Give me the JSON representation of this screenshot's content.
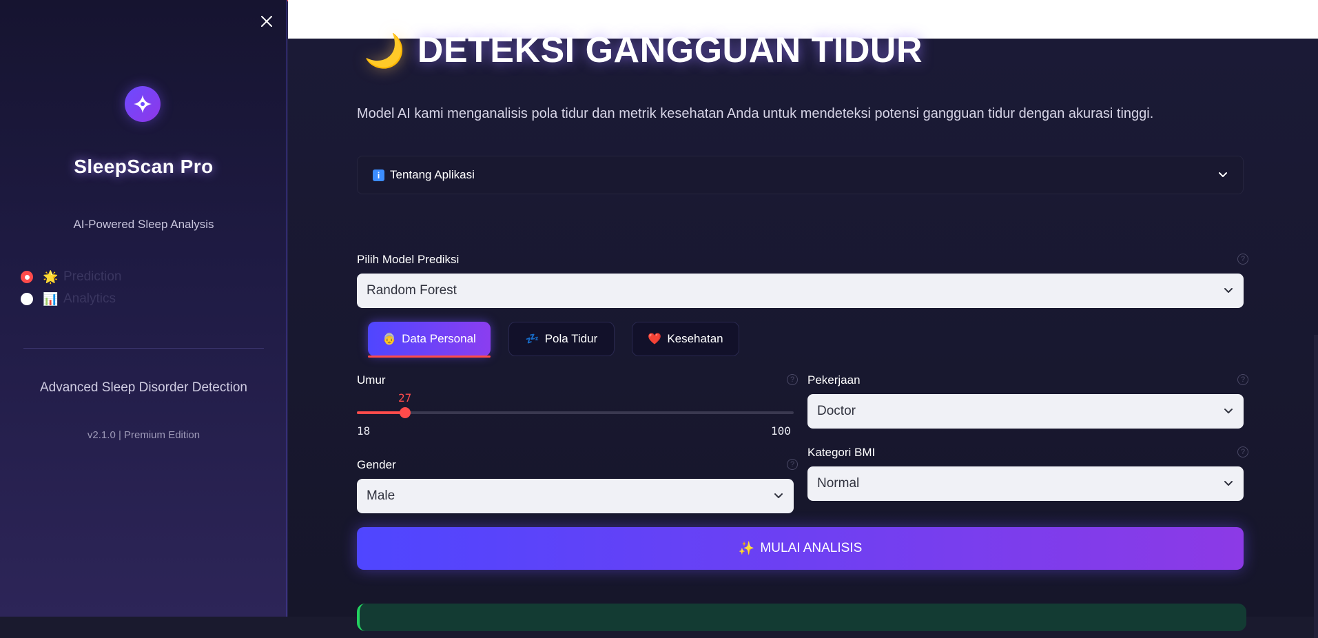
{
  "sidebar": {
    "app_name": "SleepScan Pro",
    "tagline": "AI-Powered Sleep Analysis",
    "nav": [
      {
        "emoji": "🌟",
        "label": "Prediction",
        "selected": true
      },
      {
        "emoji": "📊",
        "label": "Analytics",
        "selected": false
      }
    ],
    "footer_title": "Advanced Sleep Disorder Detection",
    "version": "v2.1.0 | Premium Edition"
  },
  "main": {
    "title_emoji": "🌙",
    "title": "DETEKSI GANGGUAN TIDUR",
    "description": "Model AI kami menganalisis pola tidur dan metrik kesehatan Anda untuk mendeteksi potensi gangguan tidur dengan akurasi tinggi.",
    "expander_label": "Tentang Aplikasi",
    "model_select": {
      "label": "Pilih Model Prediksi",
      "value": "Random Forest"
    },
    "tabs": [
      {
        "emoji": "👵",
        "label": "Data Personal",
        "active": true
      },
      {
        "emoji": "💤",
        "label": "Pola Tidur",
        "active": false
      },
      {
        "emoji": "❤️",
        "label": "Kesehatan",
        "active": false
      }
    ],
    "age_slider": {
      "label": "Umur",
      "value": 27,
      "min": 18,
      "max": 100
    },
    "gender": {
      "label": "Gender",
      "value": "Male"
    },
    "occupation": {
      "label": "Pekerjaan",
      "value": "Doctor"
    },
    "bmi": {
      "label": "Kategori BMI",
      "value": "Normal"
    },
    "cta": {
      "emoji": "✨",
      "label": "MULAI ANALISIS"
    }
  },
  "colors": {
    "accent": "#ff4b4b",
    "gradient_start": "#4f46ff",
    "gradient_end": "#8c3ae6",
    "sidebar_bg": "#1f1b44",
    "main_bg": "#1b1a36"
  }
}
